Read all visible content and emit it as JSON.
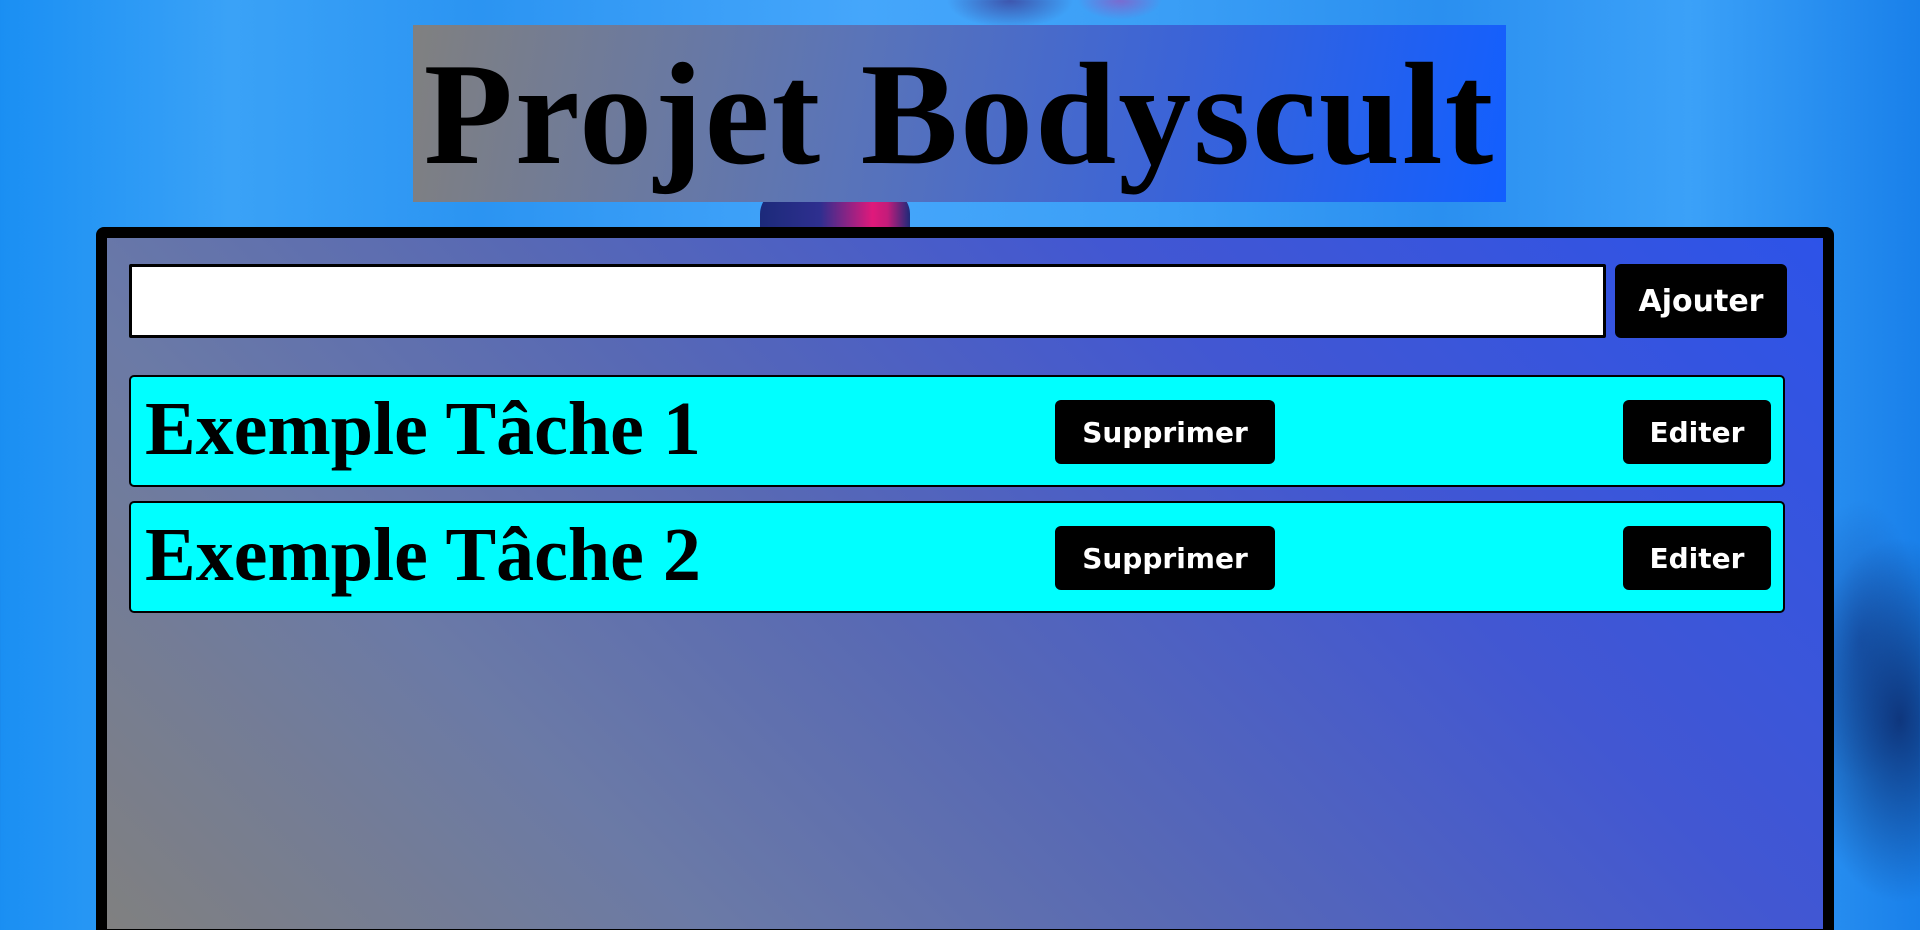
{
  "header": {
    "title": "Projet Bodyscult"
  },
  "form": {
    "input_value": "",
    "input_placeholder": "",
    "add_label": "Ajouter"
  },
  "tasks": [
    {
      "label": "Exemple Tâche 1",
      "delete_label": "Supprimer",
      "edit_label": "Editer"
    },
    {
      "label": "Exemple Tâche 2",
      "delete_label": "Supprimer",
      "edit_label": "Editer"
    }
  ],
  "colors": {
    "task_background": "#00ffff",
    "button_background": "#000000",
    "button_text": "#ffffff"
  }
}
